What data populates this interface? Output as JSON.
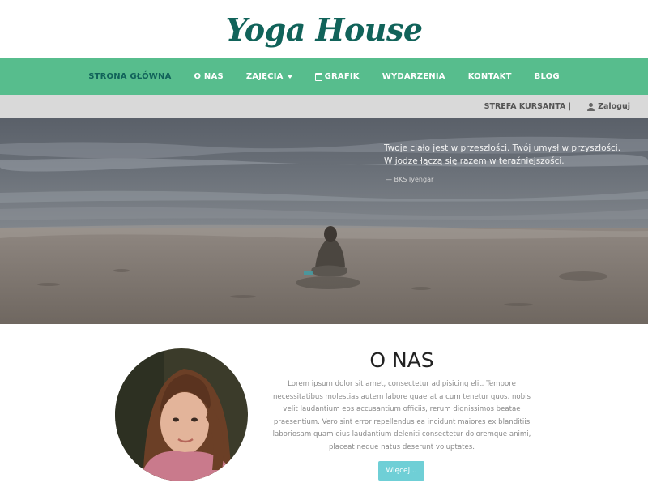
{
  "brand": {
    "name": "Yoga House"
  },
  "nav": {
    "items": [
      {
        "label": "STRONA GŁÓWNA"
      },
      {
        "label": "O NAS"
      },
      {
        "label": "ZAJĘCIA"
      },
      {
        "label": "GRAFIK"
      },
      {
        "label": "WYDARZENIA"
      },
      {
        "label": "KONTAKT"
      },
      {
        "label": "BLOG"
      }
    ]
  },
  "student_bar": {
    "label": "STREFA KURSANTA |",
    "login": "Zaloguj"
  },
  "hero": {
    "quote": "Twoje ciało jest w przeszłości. Twój umysł w przyszłości. W jodze łączą się razem w teraźniejszości.",
    "author": "— BKS Iyengar"
  },
  "about": {
    "title": "O NAS",
    "text": "Lorem ipsum dolor sit amet, consectetur adipisicing elit. Tempore necessitatibus molestias autem labore quaerat a cum tenetur quos, nobis velit laudantium eos accusantium officiis, rerum dignissimos beatae praesentium. Vero sint error repellendus ea incidunt maiores ex blanditiis laboriosam quam eius laudantium deleniti consectetur doloremque animi, placeat neque natus deserunt voluptates.",
    "button": "Więcej..."
  },
  "colors": {
    "nav": "#57bd8d",
    "accent": "#11635a",
    "button": "#6fcfd6",
    "strip": "#d9d9d9"
  }
}
